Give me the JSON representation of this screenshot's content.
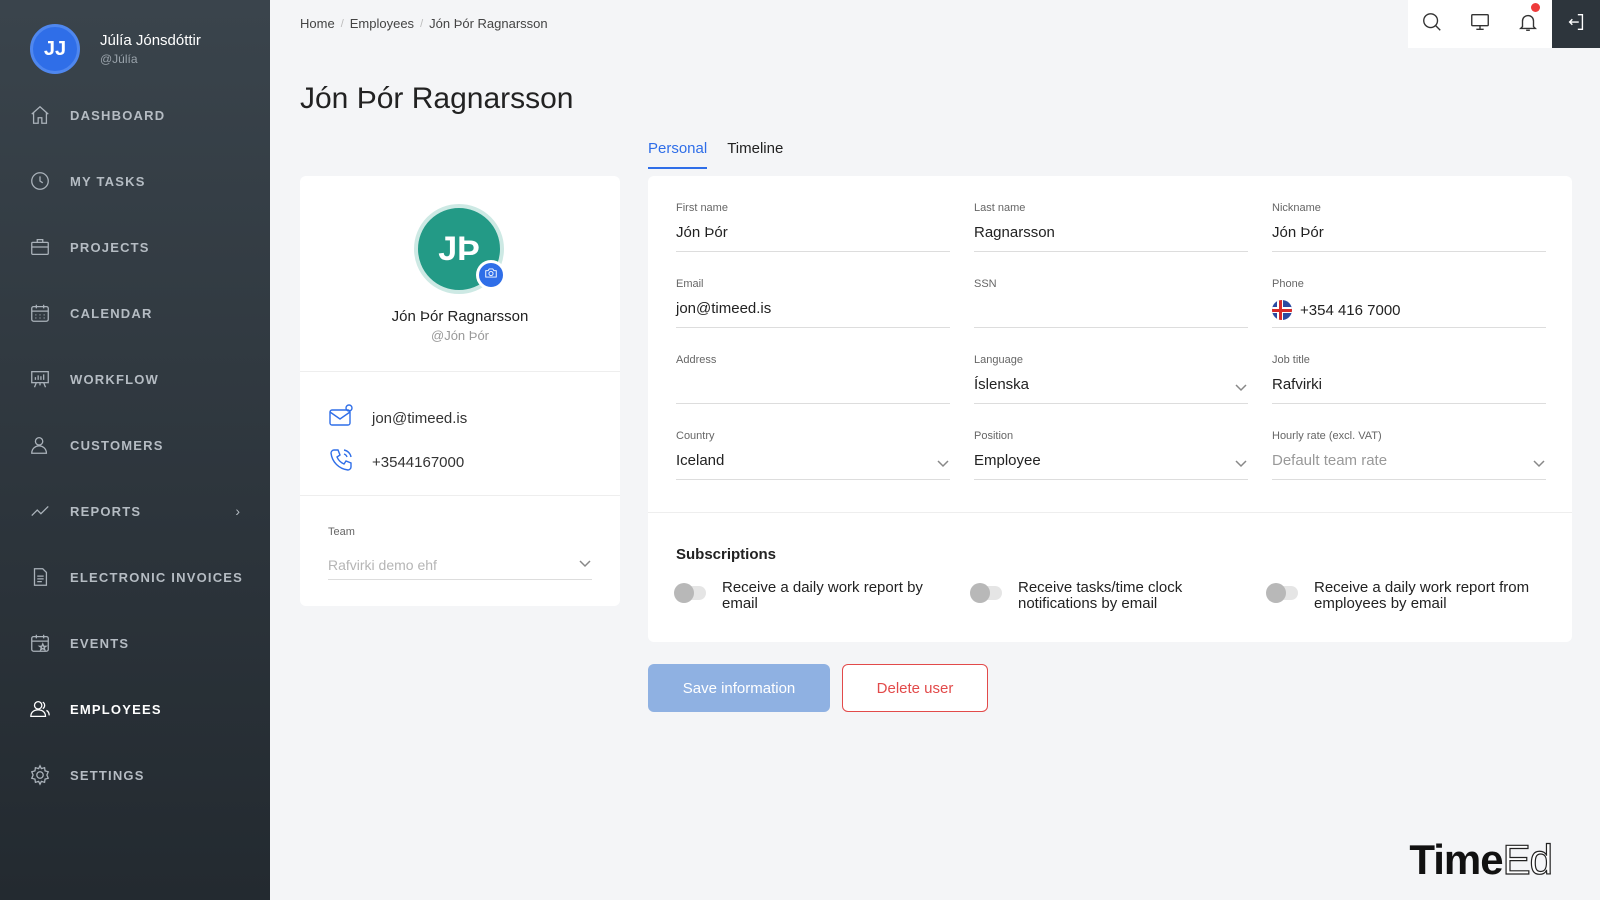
{
  "user": {
    "initials": "JJ",
    "name": "Júlía Jónsdóttir",
    "handle": "@Júlía"
  },
  "nav": [
    {
      "label": "DASHBOARD",
      "icon": "home-icon"
    },
    {
      "label": "MY TASKS",
      "icon": "clock-icon"
    },
    {
      "label": "PROJECTS",
      "icon": "briefcase-icon"
    },
    {
      "label": "CALENDAR",
      "icon": "calendar-icon"
    },
    {
      "label": "WORKFLOW",
      "icon": "board-icon"
    },
    {
      "label": "CUSTOMERS",
      "icon": "person-icon"
    },
    {
      "label": "REPORTS",
      "icon": "chart-line-icon"
    },
    {
      "label": "ELECTRONIC INVOICES",
      "icon": "document-icon"
    },
    {
      "label": "EVENTS",
      "icon": "calendar-star-icon"
    },
    {
      "label": "EMPLOYEES",
      "icon": "people-icon"
    },
    {
      "label": "SETTINGS",
      "icon": "gear-icon"
    }
  ],
  "breadcrumb": [
    "Home",
    "Employees",
    "Jón Þór Ragnarsson"
  ],
  "page_title": "Jón Þór Ragnarsson",
  "profile": {
    "initials": "JÞ",
    "name": "Jón Þór Ragnarsson",
    "handle": "@Jón Þór",
    "email": "jon@timeed.is",
    "phone": "+3544167000",
    "team_label": "Team",
    "team_value": "Rafvirki demo ehf"
  },
  "tabs": [
    "Personal",
    "Timeline"
  ],
  "fields": {
    "first_name": {
      "label": "First name",
      "value": "Jón Þór"
    },
    "last_name": {
      "label": "Last name",
      "value": "Ragnarsson"
    },
    "nickname": {
      "label": "Nickname",
      "value": "Jón Þór"
    },
    "email": {
      "label": "Email",
      "value": "jon@timeed.is"
    },
    "ssn": {
      "label": "SSN",
      "value": ""
    },
    "phone": {
      "label": "Phone",
      "value": "+354 416 7000"
    },
    "address": {
      "label": "Address",
      "value": ""
    },
    "language": {
      "label": "Language",
      "value": "Íslenska"
    },
    "job_title": {
      "label": "Job title",
      "value": "Rafvirki"
    },
    "country": {
      "label": "Country",
      "value": "Iceland"
    },
    "position": {
      "label": "Position",
      "value": "Employee"
    },
    "hourly_rate": {
      "label": "Hourly rate (excl. VAT)",
      "value": "Default team rate"
    }
  },
  "subscriptions": {
    "title": "Subscriptions",
    "items": [
      {
        "label": "Receive a daily work report by email",
        "enabled": false
      },
      {
        "label": "Receive tasks/time clock notifications by email",
        "enabled": false
      },
      {
        "label": "Receive a daily work report from employees by email",
        "enabled": false
      }
    ]
  },
  "buttons": {
    "save": "Save information",
    "delete": "Delete user"
  },
  "brand": {
    "bold": "Time",
    "light": "Ed"
  },
  "colors": {
    "accent": "#2f6ee8",
    "danger": "#e24a4a",
    "sidebar": "#2c343b"
  }
}
